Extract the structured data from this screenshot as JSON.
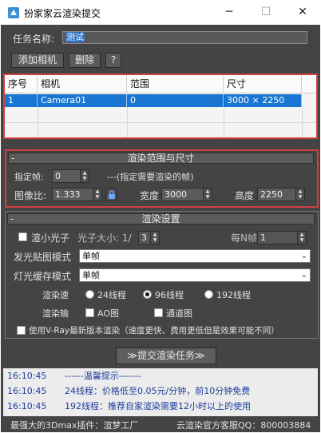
{
  "window": {
    "title": "扮家家云渲染提交",
    "minimize": "─",
    "maximize": "☐",
    "close": "✕"
  },
  "task": {
    "name_label": "任务名称:",
    "name_value": "测试",
    "add_camera": "添加相机",
    "delete": "删除",
    "help": "?"
  },
  "table": {
    "columns": [
      "序号",
      "相机",
      "范围",
      "尺寸"
    ],
    "rows": [
      [
        "1",
        "Camera01",
        "0",
        "3000 × 2250"
      ]
    ]
  },
  "range": {
    "header_minus": "-",
    "header": "渲染范围与尺寸",
    "frame_label": "指定帧:",
    "frame_value": "0",
    "frame_hint": "---(指定需要渲染的帧)",
    "ratio_label": "图像比:",
    "ratio_value": "1.333",
    "width_label": "宽度",
    "width_value": "3000",
    "height_label": "高度",
    "height_value": "2250"
  },
  "render": {
    "header_minus": "-",
    "header": "渲染设置",
    "small_photon_label": "渲小光子",
    "photon_size_label": "光子大小: 1/",
    "photon_size_value": "3",
    "every_n_label": "每N帧",
    "every_n_value": "1",
    "irradiance_label": "发光贴图模式",
    "irradiance_value": "单帧",
    "lightcache_label": "灯光缓存模式",
    "lightcache_value": "单帧",
    "speed_label": "渲染速",
    "speed_options": [
      "24线程",
      "96线程",
      "192线程"
    ],
    "speed_selected": "96线程",
    "output_label": "渲染输",
    "output_options": [
      "AO图",
      "通道图"
    ],
    "vray_label": "使用V-Ray最新版本渲染（速度更快、费用更低但是效果可能不同）"
  },
  "submit": "≫提交渲染任务≫",
  "log": [
    {
      "time": "16:10:45",
      "msg": "------温馨提示-------"
    },
    {
      "time": "16:10:45",
      "msg": "24线程：价格低至0.05元/分钟，前10分钟免费"
    },
    {
      "time": "16:10:45",
      "msg": "192线程：推荐自家渲染需要12小时以上的使用"
    }
  ],
  "footer": {
    "left": "最强大的3Dmax插件：渲梦工厂",
    "right": "云渲染官方客服QQ：800003884"
  },
  "colors": {
    "panel": "#444444",
    "highlight_border": "#d04040",
    "selection": "#1976d2",
    "log_text": "#1d3c9a"
  }
}
